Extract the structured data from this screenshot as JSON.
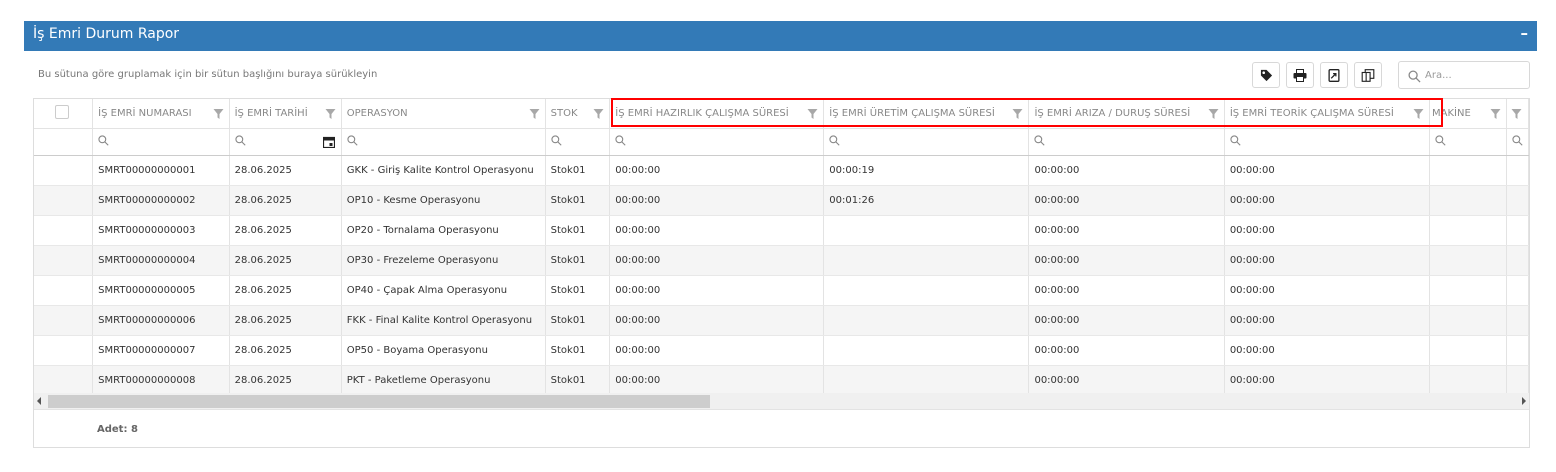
{
  "panel": {
    "title": "İş Emri Durum Rapor",
    "collapse_symbol": "–"
  },
  "grouping_hint": "Bu sütuna göre gruplamak için bir sütun başlığını buraya sürükleyin",
  "toolbar": {
    "buttons": [
      {
        "name": "tag-button",
        "icon": "tag-icon"
      },
      {
        "name": "print-button",
        "icon": "print-icon"
      },
      {
        "name": "export-button",
        "icon": "export-icon"
      },
      {
        "name": "column-chooser-button",
        "icon": "column-chooser-icon"
      }
    ],
    "search_placeholder": "Ara..."
  },
  "columns": [
    {
      "key": "is_emri_no",
      "label": "İŞ EMRİ NUMARASI"
    },
    {
      "key": "tarih",
      "label": "İŞ EMRİ TARİHİ"
    },
    {
      "key": "operasyon",
      "label": "OPERASYON"
    },
    {
      "key": "stok",
      "label": "STOK"
    },
    {
      "key": "hazirlik",
      "label": "İŞ EMRİ HAZIRLIK ÇALIŞMA SÜRESİ"
    },
    {
      "key": "uretim",
      "label": "İŞ EMRİ ÜRETİM ÇALIŞMA SÜRESİ"
    },
    {
      "key": "ariza",
      "label": "İŞ EMRİ ARIZA / DURUŞ SÜRESİ"
    },
    {
      "key": "teorik",
      "label": "İŞ EMRİ TEORİK ÇALIŞMA SÜRESİ"
    },
    {
      "key": "makine",
      "label": "MAKİNE"
    }
  ],
  "rows": [
    [
      "SMRT00000000001",
      "28.06.2025",
      "GKK - Giriş Kalite Kontrol Operasyonu",
      "Stok01",
      "00:00:00",
      "00:00:19",
      "00:00:00",
      "00:00:00",
      ""
    ],
    [
      "SMRT00000000002",
      "28.06.2025",
      "OP10 - Kesme Operasyonu",
      "Stok01",
      "00:00:00",
      "00:01:26",
      "00:00:00",
      "00:00:00",
      ""
    ],
    [
      "SMRT00000000003",
      "28.06.2025",
      "OP20 - Tornalama Operasyonu",
      "Stok01",
      "00:00:00",
      "",
      "00:00:00",
      "00:00:00",
      ""
    ],
    [
      "SMRT00000000004",
      "28.06.2025",
      "OP30 - Frezeleme Operasyonu",
      "Stok01",
      "00:00:00",
      "",
      "00:00:00",
      "00:00:00",
      ""
    ],
    [
      "SMRT00000000005",
      "28.06.2025",
      "OP40 - Çapak Alma Operasyonu",
      "Stok01",
      "00:00:00",
      "",
      "00:00:00",
      "00:00:00",
      ""
    ],
    [
      "SMRT00000000006",
      "28.06.2025",
      "FKK - Final Kalite Kontrol Operasyonu",
      "Stok01",
      "00:00:00",
      "",
      "00:00:00",
      "00:00:00",
      ""
    ],
    [
      "SMRT00000000007",
      "28.06.2025",
      "OP50 - Boyama Operasyonu",
      "Stok01",
      "00:00:00",
      "",
      "00:00:00",
      "00:00:00",
      ""
    ],
    [
      "SMRT00000000008",
      "28.06.2025",
      "PKT - Paketleme Operasyonu",
      "Stok01",
      "00:00:00",
      "",
      "00:00:00",
      "00:00:00",
      ""
    ]
  ],
  "footer": {
    "count_label": "Adet: 8"
  },
  "colors": {
    "header_bg": "#337ab7",
    "highlight": "#ff0000",
    "alt_row": "#f5f5f5"
  }
}
